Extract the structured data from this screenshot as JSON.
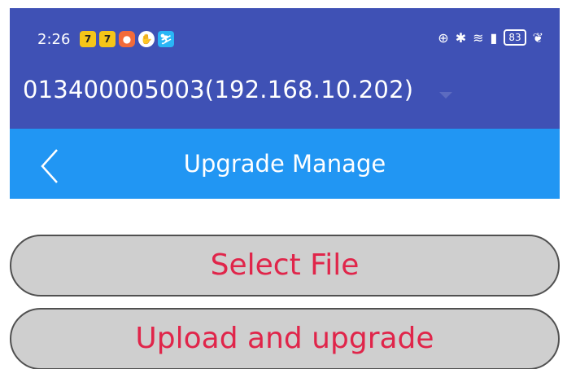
{
  "status_bar": {
    "time": "2:26",
    "battery": "83",
    "notification_icons": [
      "seven-icon",
      "seven-icon",
      "red-app-icon",
      "circle-app-icon",
      "blue-app-icon"
    ],
    "system_icons": [
      "nfc-icon",
      "bluetooth-icon",
      "wifi-icon",
      "signal-icon",
      "battery-icon",
      "leaf-icon"
    ]
  },
  "device_selector": {
    "value": "013400005003(192.168.10.202)"
  },
  "header": {
    "title": "Upgrade Manage",
    "back_icon": "chevron-left-icon"
  },
  "actions": {
    "select_file_label": "Select File",
    "upload_label": "Upload and upgrade"
  },
  "colors": {
    "status_bar": "#3f51b5",
    "title_bar": "#2196f3",
    "button_bg": "#cfcfcf",
    "button_text": "#e0254a"
  }
}
